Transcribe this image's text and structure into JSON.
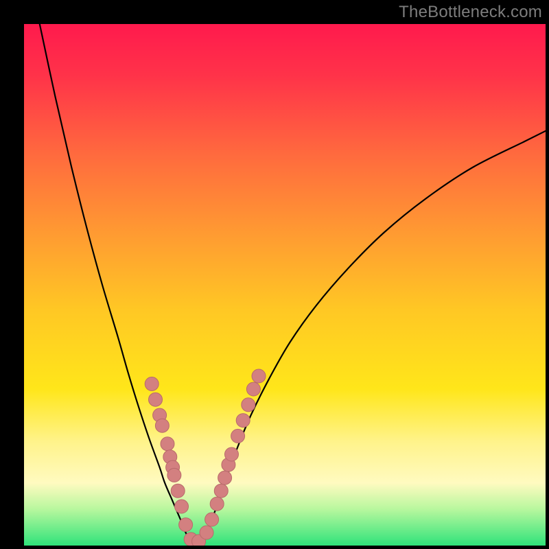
{
  "watermark": {
    "text": "TheBottleneck.com"
  },
  "plot": {
    "inner_x": 35,
    "inner_y": 35,
    "inner_w": 760,
    "inner_h": 760,
    "gradient_stops": [
      {
        "offset": 0.0,
        "color": "#ff1a4d"
      },
      {
        "offset": 0.1,
        "color": "#ff3349"
      },
      {
        "offset": 0.25,
        "color": "#ff6a3e"
      },
      {
        "offset": 0.4,
        "color": "#ff9a32"
      },
      {
        "offset": 0.55,
        "color": "#ffc824"
      },
      {
        "offset": 0.7,
        "color": "#ffe61a"
      },
      {
        "offset": 0.8,
        "color": "#fff38a"
      },
      {
        "offset": 0.88,
        "color": "#fffac0"
      },
      {
        "offset": 0.93,
        "color": "#b8f79e"
      },
      {
        "offset": 1.0,
        "color": "#2fe37a"
      }
    ],
    "curve_stroke": "#000000",
    "marker_fill": "#d38080",
    "marker_stroke": "#b86a6a"
  },
  "chart_data": {
    "type": "line",
    "title": "",
    "xlabel": "",
    "ylabel": "",
    "xlim": [
      0,
      100
    ],
    "ylim": [
      0,
      100
    ],
    "series": [
      {
        "name": "left-branch",
        "x": [
          3,
          6,
          9,
          12,
          15,
          18,
          20,
          22,
          24,
          26,
          27,
          28.5,
          30,
          31,
          32
        ],
        "y": [
          100,
          86,
          73,
          61,
          50,
          40,
          33,
          26.5,
          20.5,
          15,
          12,
          8.5,
          5,
          2.5,
          0.5
        ]
      },
      {
        "name": "right-branch",
        "x": [
          32,
          33,
          34,
          35,
          36,
          37.5,
          39,
          41,
          43.5,
          47,
          51,
          56,
          62,
          69,
          77,
          86,
          96,
          100
        ],
        "y": [
          0.5,
          0.6,
          1.2,
          2.5,
          5,
          9,
          13.5,
          19,
          25,
          32,
          39,
          46,
          53,
          60,
          66.5,
          72.5,
          77.5,
          79.5
        ]
      }
    ],
    "markers": {
      "name": "highlighted-points",
      "points": [
        {
          "x": 24.5,
          "y": 31.0
        },
        {
          "x": 25.2,
          "y": 28.0
        },
        {
          "x": 26.0,
          "y": 25.0
        },
        {
          "x": 26.5,
          "y": 23.0
        },
        {
          "x": 27.5,
          "y": 19.5
        },
        {
          "x": 28.0,
          "y": 17.0
        },
        {
          "x": 28.5,
          "y": 15.0
        },
        {
          "x": 28.8,
          "y": 13.5
        },
        {
          "x": 29.5,
          "y": 10.5
        },
        {
          "x": 30.2,
          "y": 7.5
        },
        {
          "x": 31.0,
          "y": 4.0
        },
        {
          "x": 32.0,
          "y": 1.2
        },
        {
          "x": 33.5,
          "y": 0.8
        },
        {
          "x": 35.0,
          "y": 2.5
        },
        {
          "x": 36.0,
          "y": 5.0
        },
        {
          "x": 37.0,
          "y": 8.0
        },
        {
          "x": 37.8,
          "y": 10.5
        },
        {
          "x": 38.5,
          "y": 13.0
        },
        {
          "x": 39.2,
          "y": 15.5
        },
        {
          "x": 39.8,
          "y": 17.5
        },
        {
          "x": 41.0,
          "y": 21.0
        },
        {
          "x": 42.0,
          "y": 24.0
        },
        {
          "x": 43.0,
          "y": 27.0
        },
        {
          "x": 44.0,
          "y": 30.0
        },
        {
          "x": 45.0,
          "y": 32.5
        }
      ]
    }
  }
}
